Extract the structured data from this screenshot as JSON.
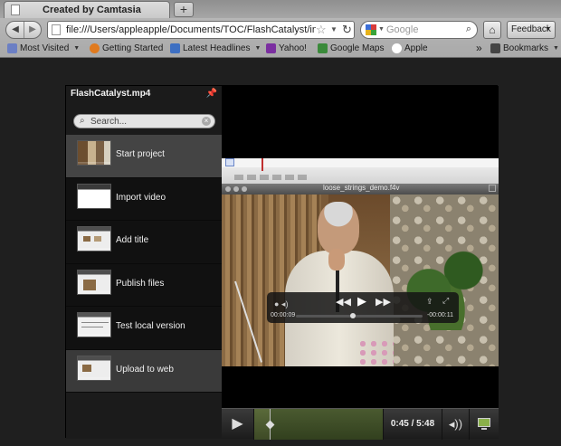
{
  "browser": {
    "tab_title": "Created by Camtasia",
    "new_tab_label": "+",
    "url": "file:///Users/appleapple/Documents/TOC/FlashCatalyst/index",
    "search_placeholder": "Google",
    "feedback_label": "Feedback",
    "bookmarks": [
      {
        "label": "Most Visited",
        "icon": "folder-icon",
        "color": "#6b7fc4",
        "dropdown": true
      },
      {
        "label": "Getting Started",
        "icon": "firefox-icon",
        "color": "#e07a1e",
        "dropdown": false
      },
      {
        "label": "Latest Headlines",
        "icon": "rss-icon",
        "color": "#3d6fc2",
        "dropdown": true
      },
      {
        "label": "Yahoo!",
        "icon": "yahoo-icon",
        "color": "#7b2fa0",
        "dropdown": false
      },
      {
        "label": "Google Maps",
        "icon": "google-icon",
        "color": "#3a8a3a",
        "dropdown": false
      },
      {
        "label": "Apple",
        "icon": "apple-icon",
        "color": "#ffffff",
        "dropdown": false
      }
    ],
    "overflow_label": "»",
    "bookmarks_menu_label": "Bookmarks"
  },
  "player": {
    "file_title": "FlashCatalyst.mp4",
    "search_placeholder": "Search...",
    "chapters": [
      {
        "label": "Start project",
        "active": true
      },
      {
        "label": "Import video",
        "active": false
      },
      {
        "label": "Add title",
        "active": false
      },
      {
        "label": "Publish files",
        "active": false
      },
      {
        "label": "Test local version",
        "active": false
      },
      {
        "label": "Upload to web",
        "active": false
      }
    ],
    "embedded_window_title": "loose_strings_demo.f4v",
    "hud": {
      "elapsed": "00:00:09",
      "remaining": "-00:00:11",
      "progress": 0.45
    },
    "time_display": "0:45 / 5:48",
    "progress": 0.13
  },
  "colors": {
    "active_chapter": "#444444",
    "scrub_fill": "#5a6a3a",
    "sidebar_bg": "#1b1b1b"
  }
}
